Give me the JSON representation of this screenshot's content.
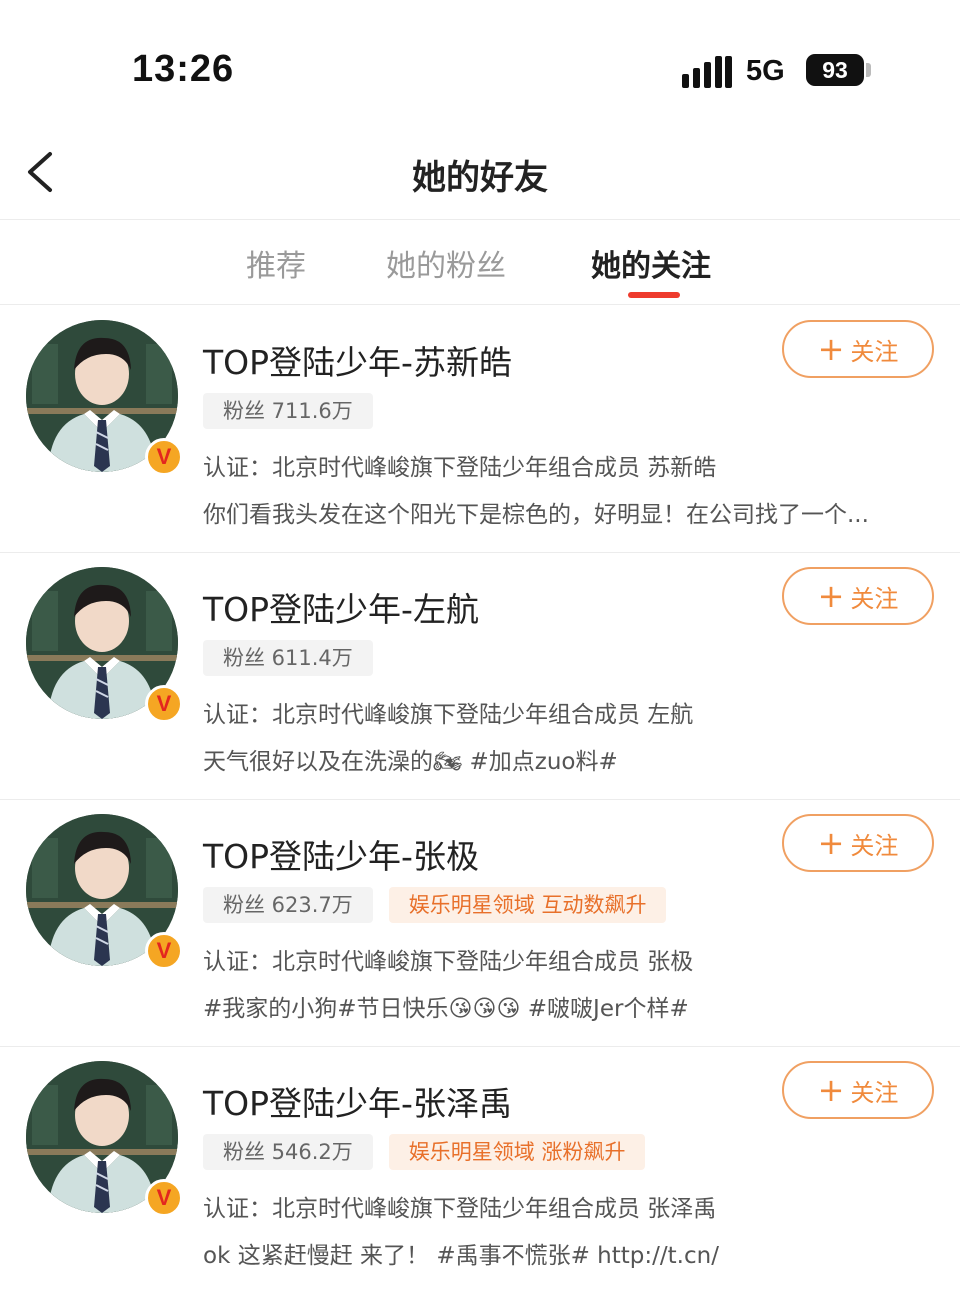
{
  "status_bar": {
    "time": "13:26",
    "network": "5G",
    "battery": "93"
  },
  "header": {
    "title": "她的好友"
  },
  "tabs": [
    {
      "label": "推荐",
      "active": false
    },
    {
      "label": "她的粉丝",
      "active": false
    },
    {
      "label": "她的关注",
      "active": true
    }
  ],
  "accent_color": "#ee3b2d",
  "follow_color": "#f08a3c",
  "follow_button": {
    "icon": "plus-icon",
    "label": "关注"
  },
  "users": [
    {
      "name": "TOP登陆少年-苏新皓",
      "fans": "粉丝 711.6万",
      "tag": "",
      "verify": "认证：北京时代峰峻旗下登陆少年组合成员 苏新皓",
      "bio": "你们看我头发在这个阳光下是棕色的，好明显！在公司找了一个..."
    },
    {
      "name": "TOP登陆少年-左航",
      "fans": "粉丝 611.4万",
      "tag": "",
      "verify": "认证：北京时代峰峻旗下登陆少年组合成员 左航",
      "bio": "天气很好以及在洗澡的🏍 #加点zuo料#"
    },
    {
      "name": "TOP登陆少年-张极",
      "fans": "粉丝 623.7万",
      "tag": "娱乐明星领域 互动数飙升",
      "verify": "认证：北京时代峰峻旗下登陆少年组合成员 张极",
      "bio": "#我家的小狗#节日快乐😘😘😘 #啵啵Jer个样#"
    },
    {
      "name": "TOP登陆少年-张泽禹",
      "fans": "粉丝 546.2万",
      "tag": "娱乐明星领域 涨粉飙升",
      "verify": "认证：北京时代峰峻旗下登陆少年组合成员 张泽禹",
      "bio": "ok 这紧赶慢赶 来了！ #禹事不慌张# http://t.cn/"
    }
  ]
}
